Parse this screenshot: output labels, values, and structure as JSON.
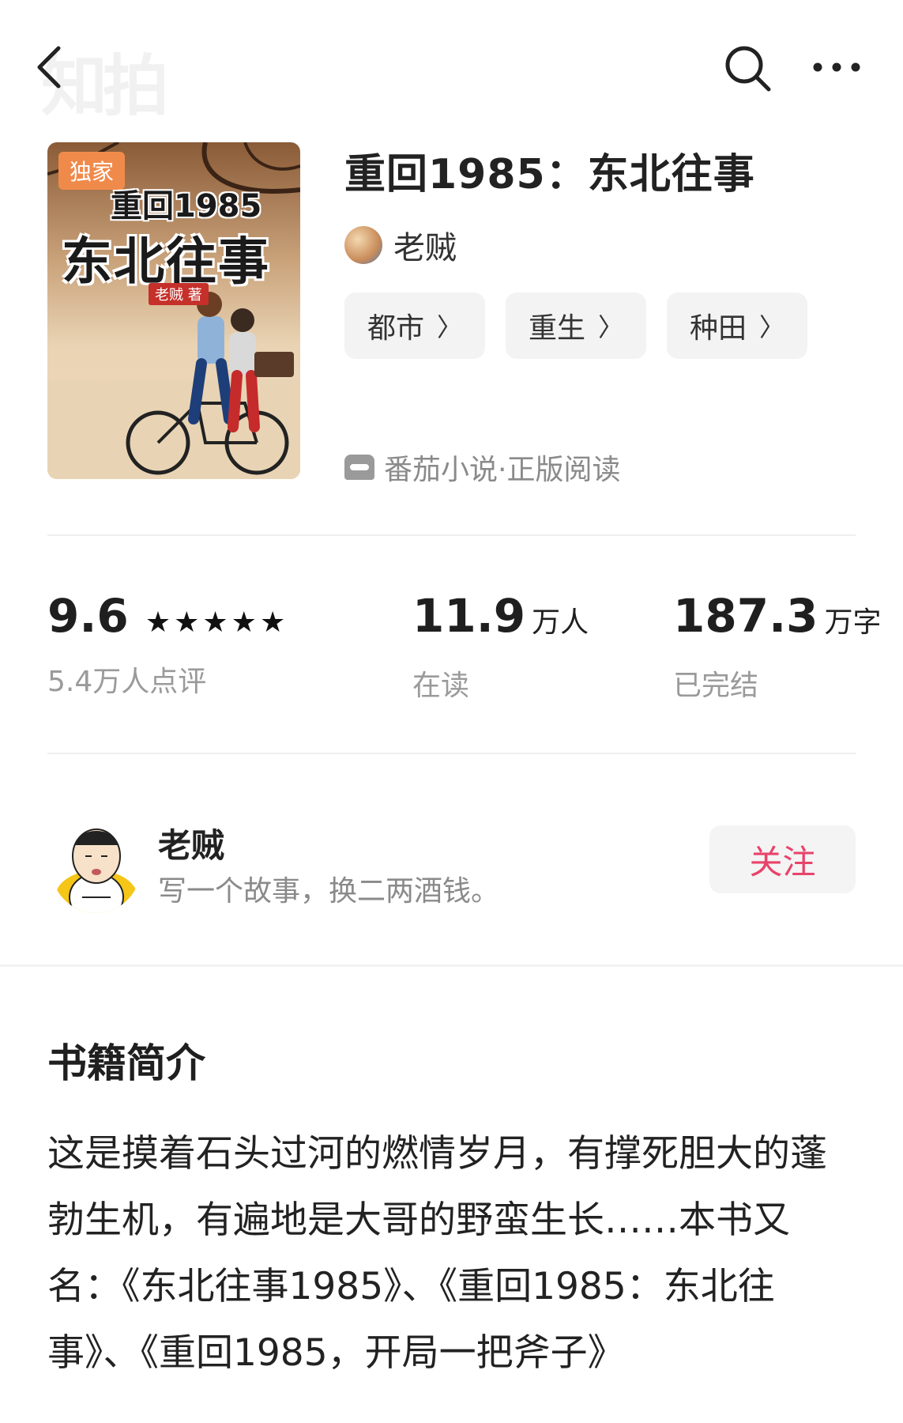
{
  "watermark": "知拍",
  "book": {
    "cover_badge": "独家",
    "cover_title_line1": "重回1985",
    "cover_title_line2": "东北往事",
    "cover_author": "老贼 著",
    "title": "重回1985：东北往事",
    "author": "老贼",
    "tags": [
      "都市",
      "重生",
      "种田"
    ],
    "source": "番茄小说·正版阅读"
  },
  "stats": {
    "rating": "9.6",
    "stars": "★★★★★",
    "reviews": "5.4万人点评",
    "readers_num": "11.9",
    "readers_unit": "万人",
    "readers_label": "在读",
    "words_num": "187.3",
    "words_unit": "万字",
    "words_label": "已完结"
  },
  "profile": {
    "name": "老贼",
    "bio": "写一个故事，换二两酒钱。",
    "follow_label": "关注"
  },
  "intro": {
    "heading": "书籍简介",
    "text": "这是摸着石头过河的燃情岁月，有撑死胆大的蓬勃生机，有遍地是大哥的野蛮生长……本书又名：《东北往事1985》、《重回1985：东北往事》、《重回1985，开局一把斧子》"
  },
  "icons": {
    "back": "chevron-left-icon",
    "search": "search-icon",
    "more": "more-dots-icon"
  },
  "colors": {
    "accent": "#e8436a",
    "badge": "#f08a4b",
    "muted": "#9a9a9a"
  }
}
